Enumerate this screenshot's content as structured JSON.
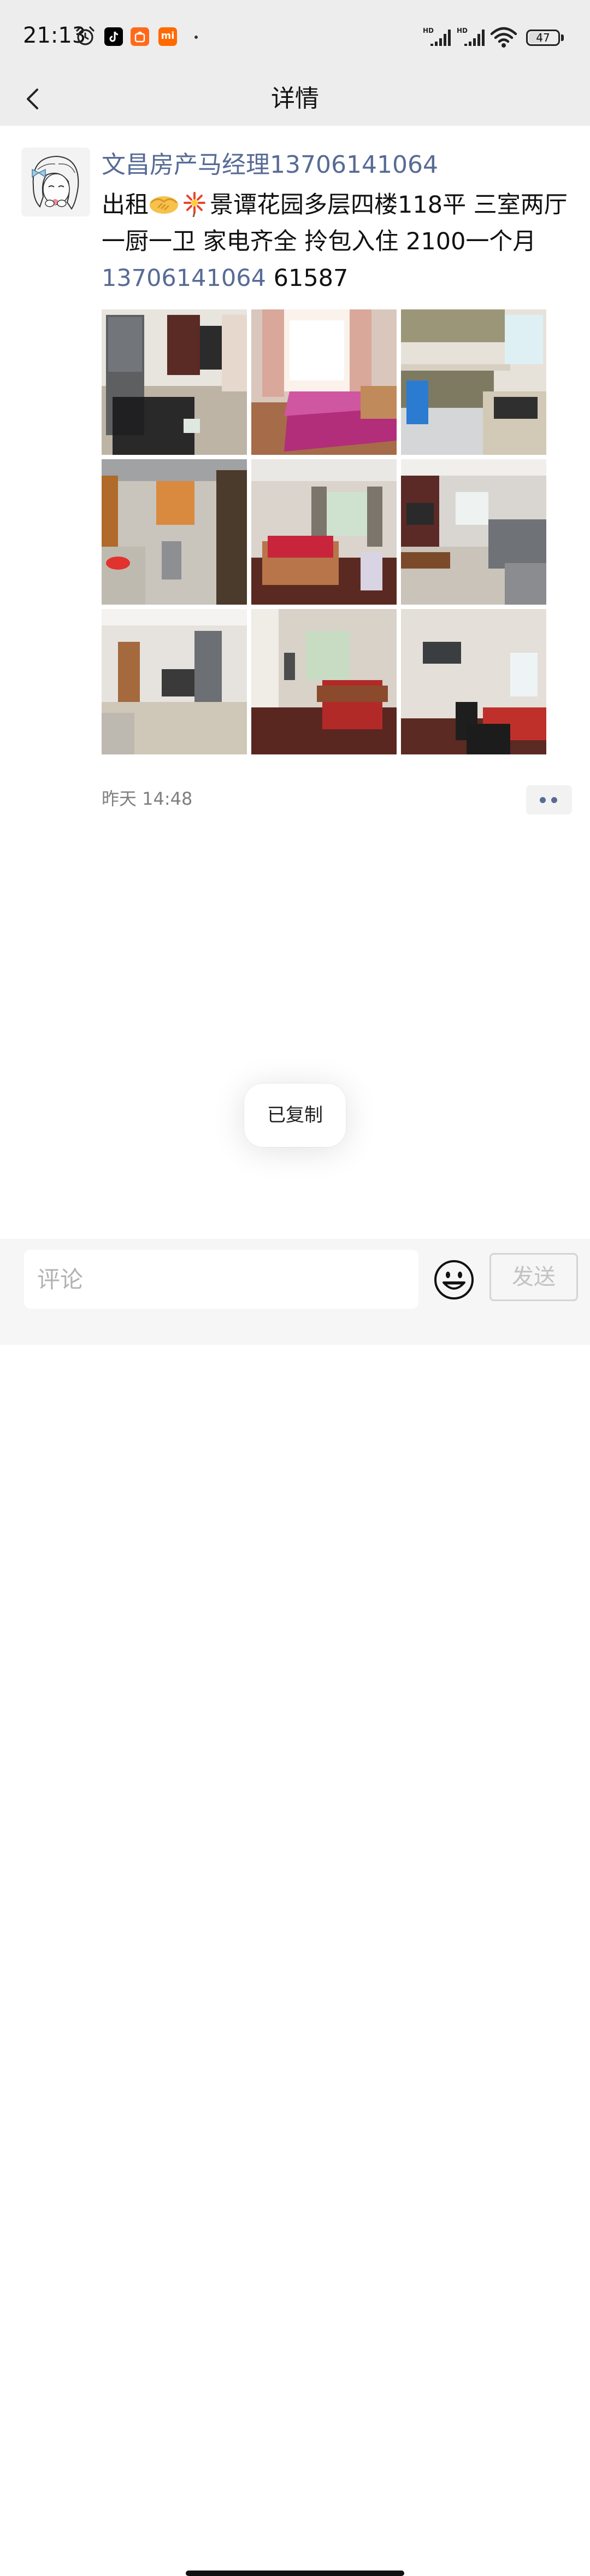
{
  "status_bar": {
    "time": "21:13",
    "battery_level": "47",
    "icons": [
      "alarm-icon",
      "tiktok-app-icon",
      "taobao-app-icon",
      "mi-app-icon",
      "signal-hd-icon",
      "signal-hd-icon",
      "wifi-icon",
      "battery-icon"
    ]
  },
  "header": {
    "title": "详情",
    "back_icon": "chevron-left-icon"
  },
  "post": {
    "author": "文昌房产马经理13706141064",
    "text_before_emoji": "出租",
    "emojis": [
      "handshake-emoji",
      "sparkler-emoji"
    ],
    "text_after_emoji": "景谭花园多层四楼118平 三室两厅一厨一卫 家电齐全  拎包入住  2100一个月 ",
    "phone_link": "13706141064",
    "text_tail": "  61587",
    "photos": [
      "living-room-with-fridge",
      "bedroom-pink-bed",
      "kitchen",
      "bathroom",
      "bedroom-red-bed",
      "living-room-sofa",
      "hallway-living-area",
      "bedroom-window",
      "room-with-tv"
    ],
    "time": "昨天 14:48"
  },
  "toast": {
    "text": "已复制"
  },
  "comment_bar": {
    "placeholder": "评论",
    "send_label": "发送"
  },
  "colors": {
    "link": "#576b95",
    "header_bg": "#ededed",
    "bar_bg": "#f6f6f6"
  }
}
